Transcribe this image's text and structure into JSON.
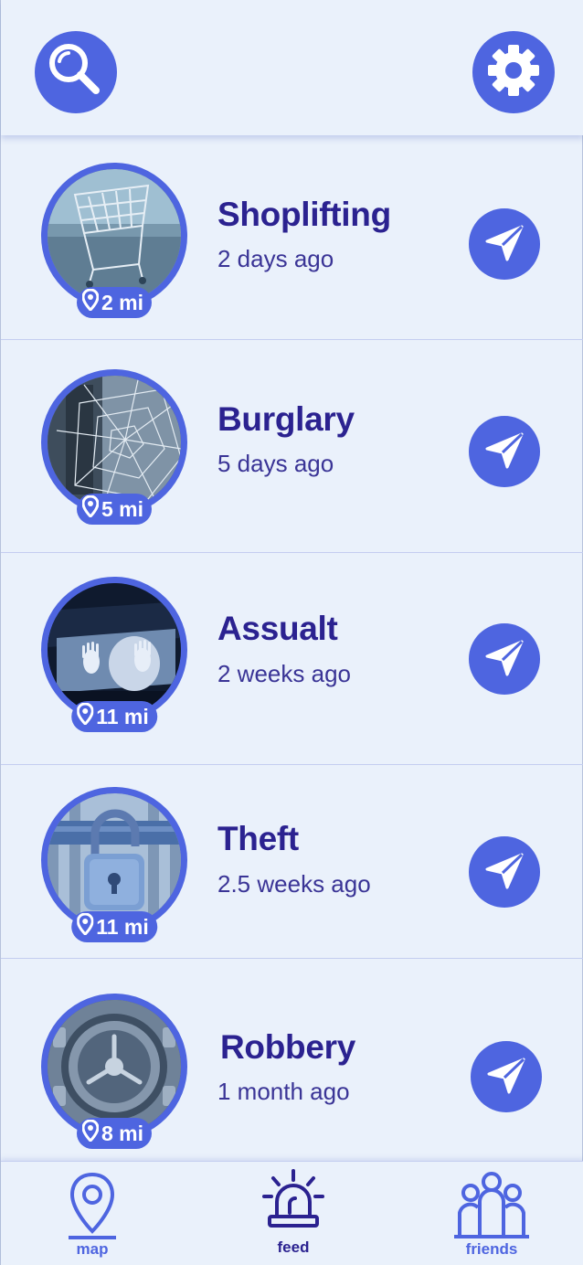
{
  "header": {
    "search_icon": "search-icon",
    "settings_icon": "gear-icon"
  },
  "colors": {
    "accent": "#4e65e0",
    "title": "#2b2290",
    "background": "#eaf1fb"
  },
  "feed": [
    {
      "title": "Shoplifting",
      "time": "2 days ago",
      "distance": "2 mi",
      "image": "shopping-cart-photo"
    },
    {
      "title": "Burglary",
      "time": " 5 days ago",
      "distance": "5 mi",
      "image": "broken-glass-photo"
    },
    {
      "title": "Assualt",
      "time": "2 weeks ago",
      "distance": "11 mi",
      "image": "car-window-hands-photo"
    },
    {
      "title": "Theft",
      "time": "2.5 weeks ago",
      "distance": "11 mi",
      "image": "padlock-photo"
    },
    {
      "title": "Robbery",
      "time": "1 month ago",
      "distance": "8 mi",
      "image": "vault-door-photo"
    }
  ],
  "nav": {
    "map": "map",
    "feed": "feed",
    "friends": "friends"
  }
}
